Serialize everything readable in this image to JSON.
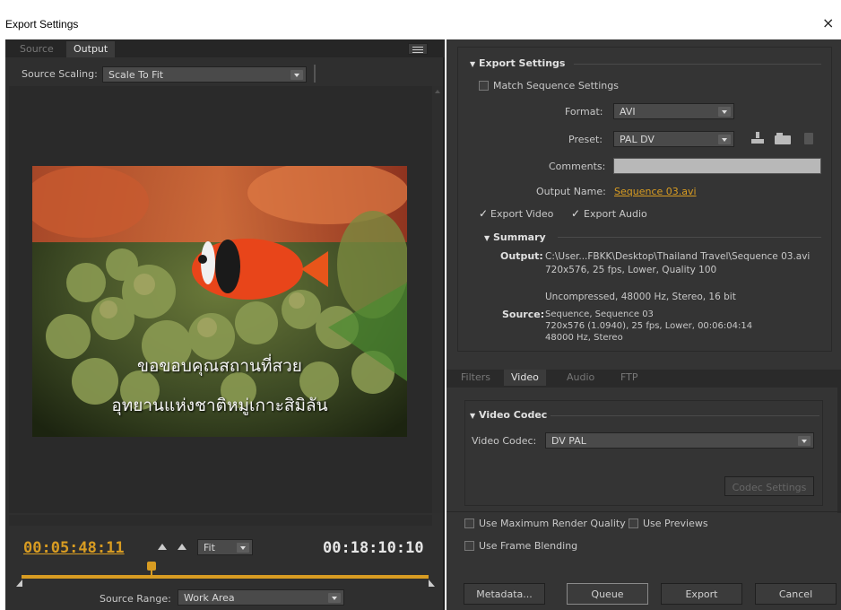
{
  "window": {
    "title": "Export Settings",
    "close": "×"
  },
  "left": {
    "tabs": [
      "Source",
      "Output"
    ],
    "source_scaling_label": "Source Scaling:",
    "source_scaling_value": "Scale To Fit",
    "subtitle_line1": "ขอขอบคุณสถานที่สวย",
    "subtitle_line2": "อุทยานแห่งชาติหมู่เกาะสิมิลัน",
    "timecode_current": "00:05:48:11",
    "timecode_duration": "00:18:10:10",
    "zoom_value": "Fit",
    "source_range_label": "Source Range:",
    "source_range_value": "Work Area"
  },
  "export": {
    "section_title": "Export Settings",
    "match_sequence_label": "Match Sequence Settings",
    "format_label": "Format:",
    "format_value": "AVI",
    "preset_label": "Preset:",
    "preset_value": "PAL DV",
    "comments_label": "Comments:",
    "comments_value": "",
    "output_name_label": "Output Name:",
    "output_name_value": "Sequence 03.avi",
    "export_video_label": "Export Video",
    "export_audio_label": "Export Audio"
  },
  "summary": {
    "title": "Summary",
    "output_label": "Output:",
    "output_lines": [
      "C:\\User...FBKK\\Desktop\\Thailand Travel\\Sequence 03.avi",
      "720x576, 25 fps, Lower, Quality 100",
      "",
      "Uncompressed, 48000 Hz, Stereo, 16 bit"
    ],
    "source_label": "Source:",
    "source_lines": [
      "Sequence, Sequence 03",
      "720x576 (1.0940), 25 fps, Lower, 00:06:04:14",
      "48000 Hz, Stereo"
    ]
  },
  "lower_tabs": [
    "Filters",
    "Video",
    "Audio",
    "FTP"
  ],
  "video_codec": {
    "section_title": "Video Codec",
    "codec_label": "Video Codec:",
    "codec_value": "DV PAL",
    "codec_settings_button": "Codec Settings"
  },
  "options": {
    "max_render_quality": "Use Maximum Render Quality",
    "use_previews": "Use Previews",
    "frame_blending": "Use Frame Blending"
  },
  "buttons": {
    "metadata": "Metadata...",
    "queue": "Queue",
    "export": "Export",
    "cancel": "Cancel"
  },
  "colors": {
    "accent_gold": "#d89c22",
    "panel_dark": "#2f2f2f",
    "panel_mid": "#343434"
  }
}
